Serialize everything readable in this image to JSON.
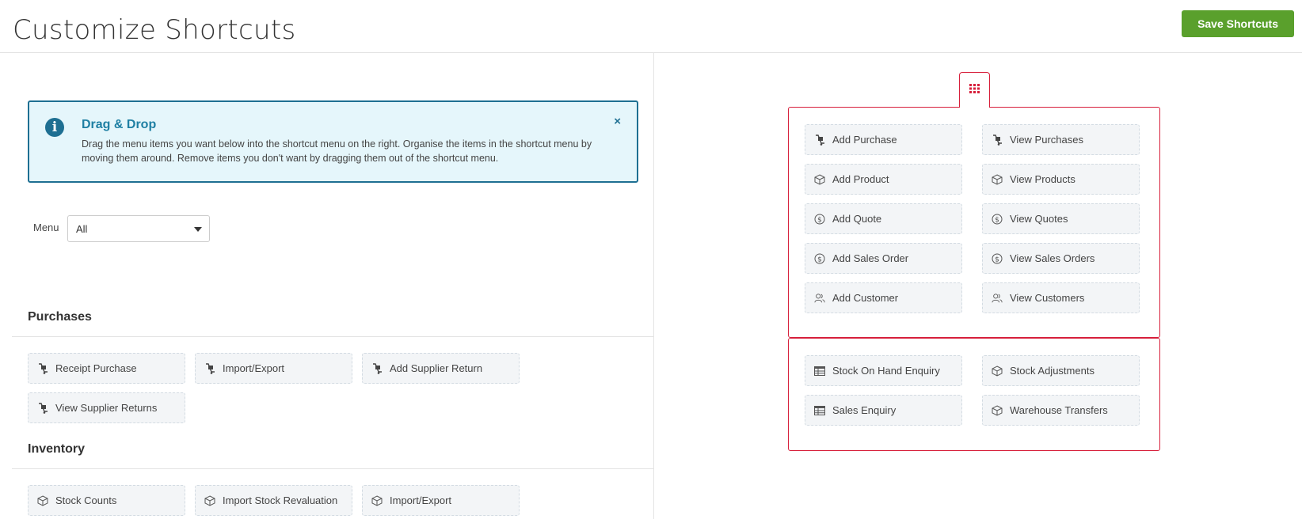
{
  "header": {
    "title": "Customize Shortcuts",
    "save_label": "Save Shortcuts"
  },
  "alert": {
    "title": "Drag & Drop",
    "body": "Drag the menu items you want below into the shortcut menu on the right. Organise the items in the shortcut menu by moving them around. Remove items you don't want by dragging them out of the shortcut menu.",
    "close": "×"
  },
  "menu_filter": {
    "label": "Menu",
    "value": "All"
  },
  "sections": {
    "purchases": {
      "title": "Purchases",
      "items": [
        {
          "label": "Receipt Purchase",
          "icon": "trolley-icon"
        },
        {
          "label": "Import/Export",
          "icon": "trolley-icon"
        },
        {
          "label": "Add Supplier Return",
          "icon": "trolley-icon"
        },
        {
          "label": "View Supplier Returns",
          "icon": "trolley-icon"
        }
      ]
    },
    "inventory": {
      "title": "Inventory",
      "items": [
        {
          "label": "Stock Counts",
          "icon": "box-icon"
        },
        {
          "label": "Import Stock Revaluation",
          "icon": "box-icon"
        },
        {
          "label": "Import/Export",
          "icon": "box-icon"
        }
      ]
    }
  },
  "shortcuts": {
    "tab_icon": "grid-icon",
    "group1": [
      {
        "label": "Add Purchase",
        "icon": "trolley-icon"
      },
      {
        "label": "View Purchases",
        "icon": "trolley-icon"
      },
      {
        "label": "Add Product",
        "icon": "box-icon"
      },
      {
        "label": "View Products",
        "icon": "box-icon"
      },
      {
        "label": "Add Quote",
        "icon": "dollar-circle-icon"
      },
      {
        "label": "View Quotes",
        "icon": "dollar-circle-icon"
      },
      {
        "label": "Add Sales Order",
        "icon": "dollar-circle-icon"
      },
      {
        "label": "View Sales Orders",
        "icon": "dollar-circle-icon"
      },
      {
        "label": "Add Customer",
        "icon": "users-icon"
      },
      {
        "label": "View Customers",
        "icon": "users-icon"
      }
    ],
    "group2": [
      {
        "label": "Stock On Hand Enquiry",
        "icon": "table-icon"
      },
      {
        "label": "Stock Adjustments",
        "icon": "box-icon"
      },
      {
        "label": "Sales Enquiry",
        "icon": "table-icon"
      },
      {
        "label": "Warehouse Transfers",
        "icon": "box-icon"
      }
    ]
  },
  "colors": {
    "accent_green": "#5aa02c",
    "alert_blue": "#1e6f92",
    "shortcut_red": "#d71f3b"
  }
}
